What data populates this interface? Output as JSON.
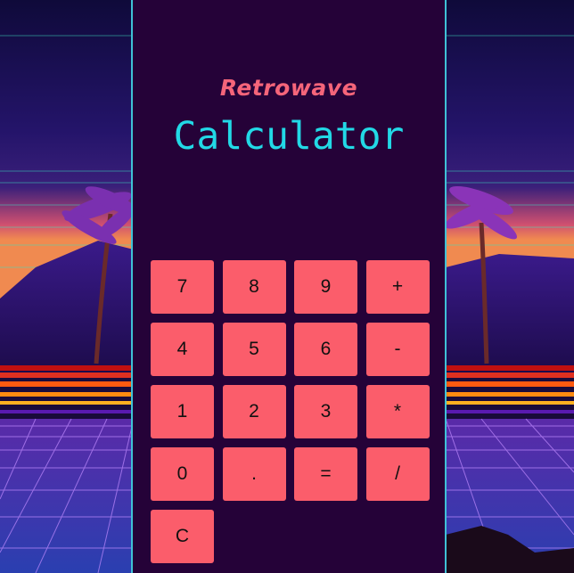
{
  "app": {
    "subtitle": "Retrowave",
    "title": "Calculator"
  },
  "keypad": {
    "keys": [
      {
        "label": "7"
      },
      {
        "label": "8"
      },
      {
        "label": "9"
      },
      {
        "label": "+"
      },
      {
        "label": "4"
      },
      {
        "label": "5"
      },
      {
        "label": "6"
      },
      {
        "label": "-"
      },
      {
        "label": "1"
      },
      {
        "label": "2"
      },
      {
        "label": "3"
      },
      {
        "label": "*"
      },
      {
        "label": "0"
      },
      {
        "label": "."
      },
      {
        "label": "="
      },
      {
        "label": "/"
      },
      {
        "label": "C"
      }
    ]
  },
  "colors": {
    "panel": "#250238",
    "panel_border": "#3fc1d6",
    "key": "#fb5d6b",
    "subtitle": "#f5657a",
    "title": "#22d9e6"
  }
}
